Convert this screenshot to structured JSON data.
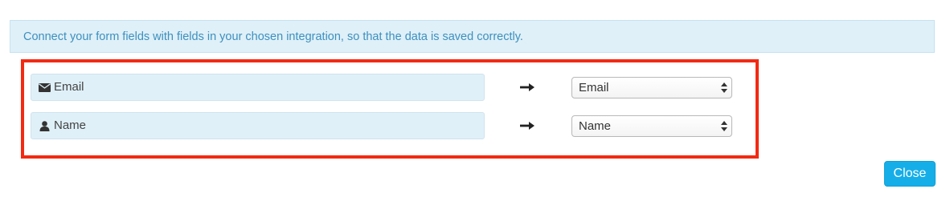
{
  "banner": {
    "text": "Connect your form fields with fields in your chosen integration, so that the data is saved correctly."
  },
  "mappings": [
    {
      "source_label": "Email",
      "source_icon": "envelope-icon",
      "target_value": "Email"
    },
    {
      "source_label": "Name",
      "source_icon": "user-icon",
      "target_value": "Name"
    }
  ],
  "footer": {
    "close_label": "Close"
  },
  "colors": {
    "banner_bg": "#dff0f8",
    "banner_text": "#3d8fbf",
    "highlight_border": "#f22a12",
    "close_button": "#16aee8"
  }
}
